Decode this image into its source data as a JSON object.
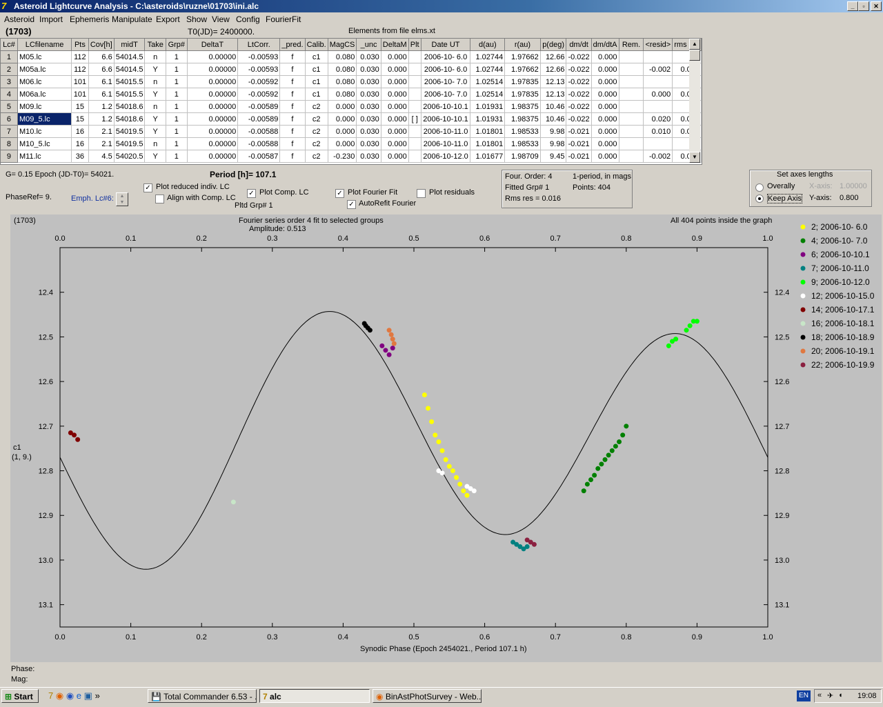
{
  "window": {
    "title": "Asteroid Lightcurve Analysis - C:\\asteroids\\ruzne\\01703\\ini.alc",
    "minimize": "_",
    "maximize": "▫",
    "close": "✕"
  },
  "menu": [
    "Asteroid",
    "Import",
    "Ephemeris",
    "Manipulate",
    "Export",
    "Show",
    "View",
    "Config",
    "FourierFit"
  ],
  "header": {
    "object": "(1703)",
    "t0": "T0(JD)= 2400000.",
    "elements": "Elements from file elms.xt"
  },
  "grid": {
    "columns": [
      "Lc#",
      "LCfilename",
      "Pts",
      "Cov[h]",
      "midT",
      "Take",
      "Grp#",
      "DeltaT",
      "LtCorr.",
      "_pred.",
      "Calib.",
      "MagCS",
      "_unc",
      "DeltaM",
      "Plt",
      "Date UT",
      "d(au)",
      "r(au)",
      "p(deg)",
      "dm/dt",
      "dm/dtA",
      "Rem.",
      "<resid>",
      "rms res"
    ],
    "rows": [
      [
        "1",
        "M05.lc",
        "112",
        "6.6",
        "54014.5",
        "n",
        "1",
        "0.00000",
        "-0.00593",
        "f",
        "c1",
        "0.080",
        "0.030",
        "0.000",
        "",
        "2006-10- 6.0",
        "1.02744",
        "1.97662",
        "12.66",
        "-0.022",
        "0.000",
        "",
        "",
        ""
      ],
      [
        "2",
        "M05a.lc",
        "112",
        "6.6",
        "54014.5",
        "Y",
        "1",
        "0.00000",
        "-0.00593",
        "f",
        "c1",
        "0.080",
        "0.030",
        "0.000",
        "",
        "2006-10- 6.0",
        "1.02744",
        "1.97662",
        "12.66",
        "-0.022",
        "0.000",
        "",
        "-0.002",
        "0.009"
      ],
      [
        "3",
        "M06.lc",
        "101",
        "6.1",
        "54015.5",
        "n",
        "1",
        "0.00000",
        "-0.00592",
        "f",
        "c1",
        "0.080",
        "0.030",
        "0.000",
        "",
        "2006-10- 7.0",
        "1.02514",
        "1.97835",
        "12.13",
        "-0.022",
        "0.000",
        "",
        "",
        ""
      ],
      [
        "4",
        "M06a.lc",
        "101",
        "6.1",
        "54015.5",
        "Y",
        "1",
        "0.00000",
        "-0.00592",
        "f",
        "c1",
        "0.080",
        "0.030",
        "0.000",
        "",
        "2006-10- 7.0",
        "1.02514",
        "1.97835",
        "12.13",
        "-0.022",
        "0.000",
        "",
        "0.000",
        "0.013"
      ],
      [
        "5",
        "M09.lc",
        "15",
        "1.2",
        "54018.6",
        "n",
        "1",
        "0.00000",
        "-0.00589",
        "f",
        "c2",
        "0.000",
        "0.030",
        "0.000",
        "",
        "2006-10-10.1",
        "1.01931",
        "1.98375",
        "10.46",
        "-0.022",
        "0.000",
        "",
        "",
        ""
      ],
      [
        "6",
        "M09_5.lc",
        "15",
        "1.2",
        "54018.6",
        "Y",
        "1",
        "0.00000",
        "-0.00589",
        "f",
        "c2",
        "0.000",
        "0.030",
        "0.000",
        "[ ]",
        "2006-10-10.1",
        "1.01931",
        "1.98375",
        "10.46",
        "-0.022",
        "0.000",
        "",
        "0.020",
        "0.022"
      ],
      [
        "7",
        "M10.lc",
        "16",
        "2.1",
        "54019.5",
        "Y",
        "1",
        "0.00000",
        "-0.00588",
        "f",
        "c2",
        "0.000",
        "0.030",
        "0.000",
        "",
        "2006-10-11.0",
        "1.01801",
        "1.98533",
        "9.98",
        "-0.021",
        "0.000",
        "",
        "0.010",
        "0.012"
      ],
      [
        "8",
        "M10_5.lc",
        "16",
        "2.1",
        "54019.5",
        "n",
        "1",
        "0.00000",
        "-0.00588",
        "f",
        "c2",
        "0.000",
        "0.030",
        "0.000",
        "",
        "2006-10-11.0",
        "1.01801",
        "1.98533",
        "9.98",
        "-0.021",
        "0.000",
        "",
        "",
        ""
      ],
      [
        "9",
        "M11.lc",
        "36",
        "4.5",
        "54020.5",
        "Y",
        "1",
        "0.00000",
        "-0.00587",
        "f",
        "c2",
        "-0.230",
        "0.030",
        "0.000",
        "",
        "2006-10-12.0",
        "1.01677",
        "1.98709",
        "9.45",
        "-0.021",
        "0.000",
        "",
        "-0.002",
        "0.009"
      ]
    ],
    "selected_row": 5
  },
  "controls": {
    "g_epoch": "G= 0.15    Epoch (JD-T0)= 54021.",
    "period": "Period [h]= 107.1",
    "phaseref": "PhaseRef= 9.",
    "emph": "Emph. Lc#6:",
    "plot_reduced": "Plot reduced indiv. LC",
    "align_comp": "Align with Comp. LC",
    "plot_comp": "Plot Comp. LC",
    "pltd_grp": "Pltd Grp#  1",
    "plot_fourier": "Plot Fourier Fit",
    "autorefit": "AutoRefit Fourier",
    "plot_residuals": "Plot residuals",
    "check_plot_reduced": "✓",
    "check_align_comp": "",
    "check_plot_comp": "✓",
    "check_plot_fourier": "✓",
    "check_autorefit": "✓",
    "check_plot_residuals": ""
  },
  "fourier_box": {
    "order": "Four. Order:  4",
    "fitted": "Fitted Grp# 1",
    "rms": "Rms res      = 0.016",
    "one_period": "1-period, in mags",
    "points": "Points: 404"
  },
  "axes_box": {
    "title": "Set axes lengths",
    "overally": "Overally",
    "keep_axis": "Keep Axis",
    "x_label": "X-axis:",
    "x_value": "1.00000",
    "y_label": "Y-axis:",
    "y_value": "0.800"
  },
  "plot": {
    "object": "(1703)",
    "fourier_title": "Fourier series order 4 fit to selected groups",
    "amplitude": "Amplitude: 0.513",
    "inside": "All 404 points inside the graph",
    "ylabel_top": "c1",
    "ylabel_bottom": "(1, 9.)",
    "phase_label": "Phase:",
    "mag_label": "Mag:"
  },
  "chart_data": {
    "type": "scatter",
    "xlabel": "Synodic Phase (Epoch 2454021., Period 107.1 h)",
    "ylabel": "",
    "xlim": [
      0.0,
      1.0
    ],
    "ylim": [
      12.3,
      13.15
    ],
    "y_inverted": true,
    "x_ticks": [
      "0.0",
      "0.1",
      "0.2",
      "0.3",
      "0.4",
      "0.5",
      "0.6",
      "0.7",
      "0.8",
      "0.9",
      "1.0"
    ],
    "y_ticks": [
      "12.4",
      "12.5",
      "12.6",
      "12.7",
      "12.8",
      "12.9",
      "13.0",
      "13.1"
    ],
    "fit_curve": {
      "mean": 12.725,
      "a1": 0.045,
      "b1": 0.01,
      "a2": 0.0,
      "b2": 0.2565,
      "color": "#000000"
    },
    "series": [
      {
        "name": "2; 2006-10- 6.0",
        "color": "#ffff00",
        "points": [
          [
            0.515,
            12.63
          ],
          [
            0.52,
            12.66
          ],
          [
            0.525,
            12.69
          ],
          [
            0.53,
            12.72
          ],
          [
            0.535,
            12.735
          ],
          [
            0.54,
            12.755
          ],
          [
            0.545,
            12.775
          ],
          [
            0.55,
            12.79
          ],
          [
            0.555,
            12.8
          ],
          [
            0.56,
            12.815
          ],
          [
            0.565,
            12.83
          ],
          [
            0.57,
            12.845
          ],
          [
            0.575,
            12.855
          ]
        ]
      },
      {
        "name": "4; 2006-10- 7.0",
        "color": "#008000",
        "points": [
          [
            0.74,
            12.845
          ],
          [
            0.745,
            12.83
          ],
          [
            0.75,
            12.82
          ],
          [
            0.755,
            12.81
          ],
          [
            0.76,
            12.795
          ],
          [
            0.765,
            12.785
          ],
          [
            0.77,
            12.775
          ],
          [
            0.775,
            12.765
          ],
          [
            0.78,
            12.755
          ],
          [
            0.785,
            12.745
          ],
          [
            0.79,
            12.735
          ],
          [
            0.795,
            12.72
          ],
          [
            0.8,
            12.7
          ]
        ]
      },
      {
        "name": "6; 2006-10-10.1",
        "color": "#800080",
        "points": [
          [
            0.455,
            12.52
          ],
          [
            0.46,
            12.53
          ],
          [
            0.465,
            12.54
          ],
          [
            0.47,
            12.525
          ]
        ]
      },
      {
        "name": "7; 2006-10-11.0",
        "color": "#008080",
        "points": [
          [
            0.64,
            12.96
          ],
          [
            0.645,
            12.965
          ],
          [
            0.65,
            12.97
          ],
          [
            0.655,
            12.975
          ],
          [
            0.66,
            12.97
          ]
        ]
      },
      {
        "name": "9; 2006-10-12.0",
        "color": "#00ff00",
        "points": [
          [
            0.86,
            12.52
          ],
          [
            0.865,
            12.51
          ],
          [
            0.87,
            12.505
          ],
          [
            0.885,
            12.485
          ],
          [
            0.89,
            12.475
          ],
          [
            0.895,
            12.465
          ],
          [
            0.9,
            12.465
          ]
        ]
      },
      {
        "name": "12; 2006-10-15.0",
        "color": "#ffffff",
        "points": [
          [
            0.535,
            12.8
          ],
          [
            0.54,
            12.805
          ],
          [
            0.575,
            12.835
          ],
          [
            0.58,
            12.84
          ],
          [
            0.585,
            12.845
          ]
        ]
      },
      {
        "name": "14; 2006-10-17.1",
        "color": "#800000",
        "points": [
          [
            0.015,
            12.715
          ],
          [
            0.02,
            12.72
          ],
          [
            0.025,
            12.73
          ]
        ]
      },
      {
        "name": "16; 2006-10-18.1",
        "color": "#c8e6c8",
        "points": [
          [
            0.245,
            12.87
          ]
        ]
      },
      {
        "name": "18; 2006-10-18.9",
        "color": "#000000",
        "points": [
          [
            0.43,
            12.47
          ],
          [
            0.432,
            12.475
          ],
          [
            0.435,
            12.48
          ],
          [
            0.438,
            12.485
          ]
        ]
      },
      {
        "name": "20; 2006-10-19.1",
        "color": "#e07840",
        "points": [
          [
            0.465,
            12.485
          ],
          [
            0.468,
            12.495
          ],
          [
            0.47,
            12.505
          ],
          [
            0.472,
            12.515
          ]
        ]
      },
      {
        "name": "22; 2006-10-19.9",
        "color": "#8b2040",
        "points": [
          [
            0.66,
            12.955
          ],
          [
            0.665,
            12.96
          ],
          [
            0.67,
            12.965
          ]
        ]
      }
    ]
  },
  "taskbar": {
    "start": "Start",
    "tasks": [
      "Total Commander 6.53 - ...",
      "alc",
      "BinAstPhotSurvey - Web..."
    ],
    "lang": "EN",
    "time": "19:08"
  }
}
